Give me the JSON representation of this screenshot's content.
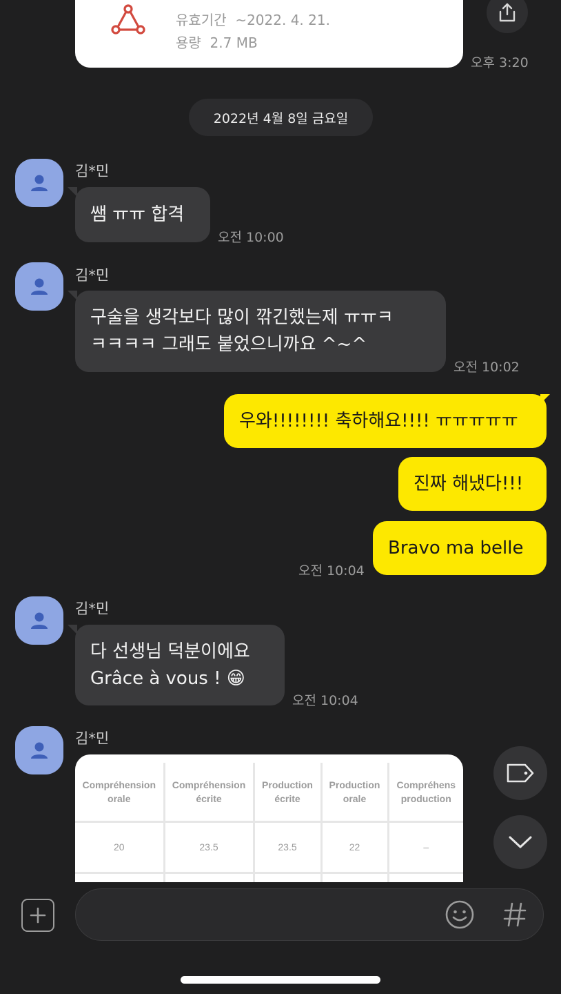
{
  "file": {
    "expiry_label": "유효기간",
    "expiry_value": "~2022. 4. 21.",
    "size_label": "용량",
    "size_value": "2.7 MB",
    "icon": "pdf-icon",
    "time": "오후 3:20"
  },
  "date_divider": "2022년 4월 8일 금요일",
  "messages": [
    {
      "sender": "김*민",
      "lines": [
        "쌤 ㅠㅠ 합격"
      ],
      "time": "오전 10:00"
    },
    {
      "sender": "김*민",
      "lines": [
        "구술을 생각보다 많이 깎긴했는제 ㅠㅠㅋ",
        "ㅋㅋㅋㅋ 그래도 붙었으니까요 ^~^"
      ],
      "time": "오전 10:02"
    },
    {
      "lines": [
        "우와!!!!!!!! 축하해요!!!! ㅠㅠㅠㅠㅠ"
      ]
    },
    {
      "lines": [
        "진짜 해냈다!!!"
      ]
    },
    {
      "lines": [
        "Bravo ma belle"
      ],
      "time": "오전 10:04"
    },
    {
      "sender": "김*민",
      "lines": [
        "다 선생님 덕분이에요",
        "Grâce à vous ! 😁"
      ],
      "time": "오전 10:04"
    },
    {
      "sender": "김*민"
    }
  ],
  "image": {
    "headers": [
      "Compréhension\norale",
      "Compréhension\nécrite",
      "Production\nécrite",
      "Production\norale",
      "Compréhens\nproduction"
    ],
    "values": [
      "20",
      "23.5",
      "23.5",
      "22",
      "–"
    ]
  },
  "colors": {
    "background": "#1f1f20",
    "incoming": "#3a3a3c",
    "outgoing": "#fde800",
    "avatar": "#8ea6e3"
  },
  "icons": {
    "share": "share-icon",
    "tag": "tag-icon",
    "scroll_down": "chevron-down-icon",
    "plus": "plus-icon",
    "emoji": "emoji-icon",
    "hash": "hash-icon",
    "avatar": "person-icon"
  }
}
